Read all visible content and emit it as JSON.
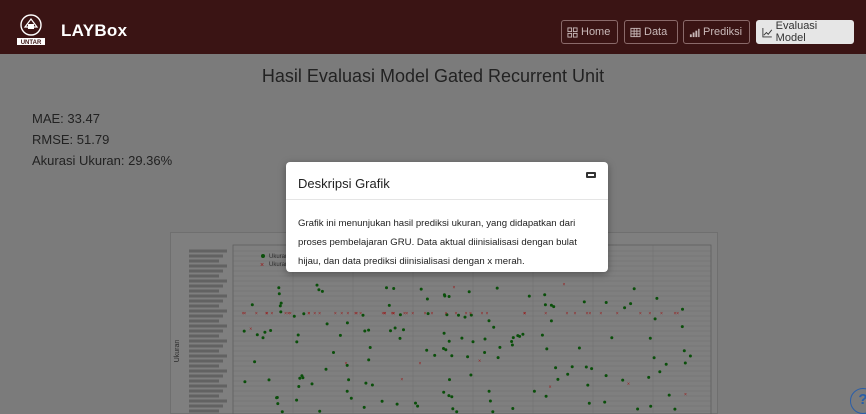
{
  "navbar": {
    "brand": "LAYBox",
    "logo_text": "UNTAR",
    "items": [
      {
        "label": "Home",
        "icon": "grid-icon"
      },
      {
        "label": "Data",
        "icon": "table-icon"
      },
      {
        "label": "Prediksi",
        "icon": "bar-chart-icon"
      },
      {
        "label": "Evaluasi Model",
        "icon": "line-chart-icon",
        "active": true
      }
    ]
  },
  "main": {
    "title": "Hasil Evaluasi Model Gated Recurrent Unit",
    "metrics": {
      "mae": "MAE: 33.47",
      "rmse": "RMSE: 51.79",
      "accuracy": "Akurasi Ukuran: 29.36%"
    }
  },
  "chart": {
    "ylabel": "Ukuran",
    "legend": [
      "Ukuran Aktual",
      "Ukuran Prediksi"
    ],
    "colors": {
      "actual": "#0a7a0a",
      "predicted": "#d21e1e"
    }
  },
  "modal": {
    "title": "Deskripsi Grafik",
    "body": "Grafik ini menunjukan hasil prediksi ukuran, yang didapatkan dari proses pembelajaran GRU. Data aktual diinisialisasi dengan bulat hijau, dan data prediksi diinisialisasi dengan x merah."
  },
  "help": {
    "label": "?"
  }
}
